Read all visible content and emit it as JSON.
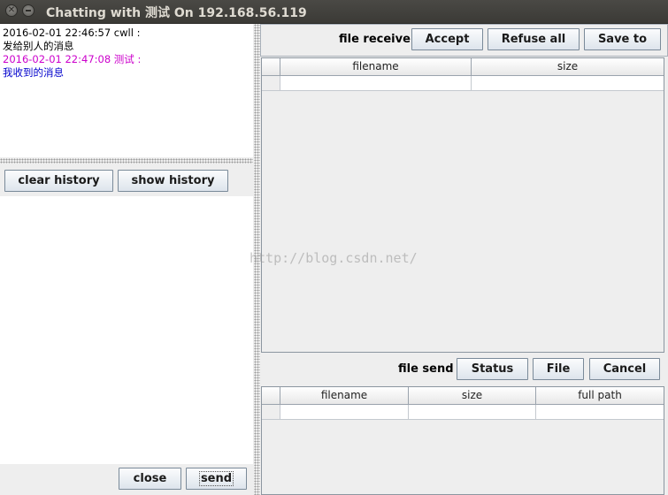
{
  "window": {
    "title": "Chatting with 测试 On 192.168.56.119",
    "close_glyph": "✕"
  },
  "chat": {
    "messages": [
      {
        "header": "2016-02-01 22:46:57 cwll :",
        "body": "发给别人的消息",
        "header_color": "#000000",
        "body_color": "#000000"
      },
      {
        "header": "2016-02-01 22:47:08 测试 :",
        "body": "我收到的消息",
        "header_color": "#cc00cc",
        "body_color": "#0000cc"
      }
    ]
  },
  "history": {
    "clear_label": "clear history",
    "show_label": "show history"
  },
  "actions": {
    "close_label": "close",
    "send_label": "send"
  },
  "file_receive": {
    "label": "file receive",
    "accept_label": "Accept",
    "refuse_all_label": "Refuse all",
    "save_to_label": "Save to",
    "columns": [
      "filename",
      "size"
    ]
  },
  "file_send": {
    "label": "file send",
    "status_label": "Status",
    "file_label": "File",
    "cancel_label": "Cancel",
    "columns": [
      "filename",
      "size",
      "full path"
    ]
  },
  "watermark": "http://blog.csdn.net/"
}
